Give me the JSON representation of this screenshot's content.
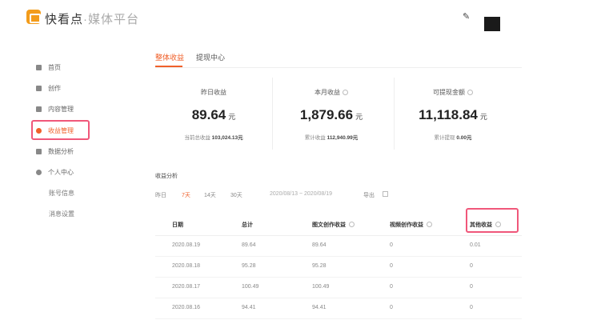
{
  "header": {
    "brand_name": "快看点",
    "brand_sub": "·媒体平台"
  },
  "sidebar": {
    "items": [
      {
        "label": "首页",
        "icon": "home-icon"
      },
      {
        "label": "创作",
        "icon": "edit-icon"
      },
      {
        "label": "内容管理",
        "icon": "document-icon"
      },
      {
        "label": "收益管理",
        "icon": "coin-icon",
        "active": true
      },
      {
        "label": "数据分析",
        "icon": "chart-icon"
      },
      {
        "label": "个人中心",
        "icon": "user-icon"
      }
    ],
    "sub_items": [
      "账号信息",
      "消息设置"
    ]
  },
  "tabs": [
    {
      "label": "整体收益",
      "active": true
    },
    {
      "label": "提现中心",
      "active": false
    }
  ],
  "stats": [
    {
      "label": "昨日收益",
      "value": "89.64",
      "unit": "元",
      "sub_label": "当前总收益",
      "sub_value": "103,024.13元",
      "info": false
    },
    {
      "label": "本月收益",
      "value": "1,879.66",
      "unit": "元",
      "sub_label": "累计收益",
      "sub_value": "112,940.99元",
      "info": true
    },
    {
      "label": "可提现金额",
      "value": "11,118.84",
      "unit": "元",
      "sub_label": "累计提现",
      "sub_value": "0.00元",
      "info": true
    }
  ],
  "analysis": {
    "title": "收益分析",
    "filters": [
      {
        "label": "昨日",
        "active": false
      },
      {
        "label": "7天",
        "active": true
      },
      {
        "label": "14天",
        "active": false
      },
      {
        "label": "30天",
        "active": false
      }
    ],
    "date_range": "2020/08/13  ~  2020/08/19",
    "export_label": "导出"
  },
  "table": {
    "headers": [
      "日期",
      "总计",
      "图文创作收益",
      "视频创作收益",
      "其他收益"
    ],
    "rows": [
      [
        "2020.08.19",
        "89.64",
        "89.64",
        "0",
        "0.01"
      ],
      [
        "2020.08.18",
        "95.28",
        "95.28",
        "0",
        "0"
      ],
      [
        "2020.08.17",
        "100.49",
        "100.49",
        "0",
        "0"
      ],
      [
        "2020.08.16",
        "94.41",
        "94.41",
        "0",
        "0"
      ]
    ]
  },
  "colors": {
    "accent": "#f0602a",
    "highlight": "#f0577a",
    "logo": "#f39c1b"
  }
}
